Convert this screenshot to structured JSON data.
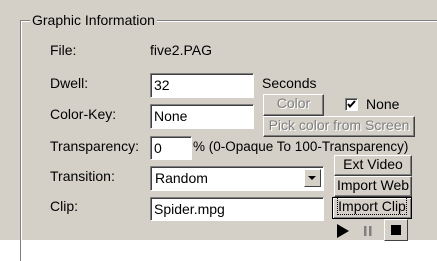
{
  "group": {
    "title": "Graphic Information"
  },
  "file": {
    "label": "File:",
    "value": "five2.PAG"
  },
  "dwell": {
    "label": "Dwell:",
    "value": "32",
    "unit": "Seconds"
  },
  "color_key": {
    "label": "Color-Key:",
    "value": "None",
    "color_button": "Color",
    "none_checkbox_label": "None",
    "none_checked": true,
    "pick_button": "Pick color from Screen"
  },
  "transparency": {
    "label": "Transparency:",
    "value": "0",
    "hint": "% (0-Opaque To 100-Transparency)"
  },
  "transition": {
    "label": "Transition:",
    "selected": "Random"
  },
  "clip": {
    "label": "Clip:",
    "value": "Spider.mpg",
    "ext_video_button": "Ext Video",
    "import_web_button": "Import Web",
    "import_clip_button": "Import Clip"
  },
  "media": {
    "play_icon": "play-icon",
    "pause_icon": "pause-icon",
    "stop_icon": "stop-icon"
  }
}
